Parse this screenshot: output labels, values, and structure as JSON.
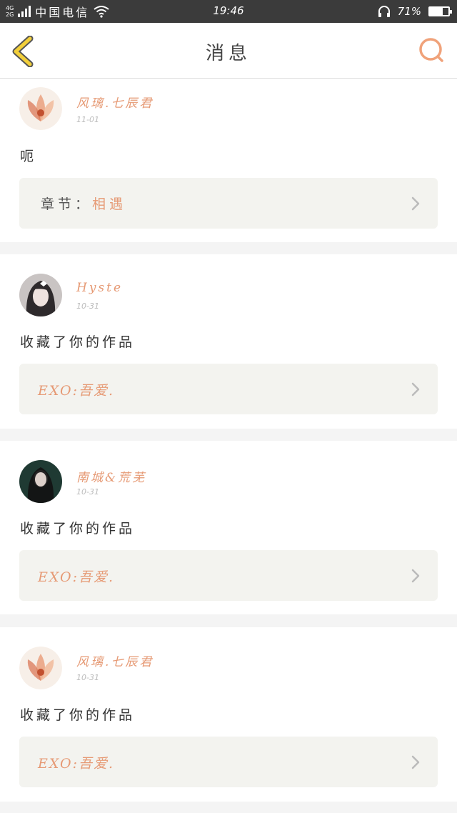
{
  "status": {
    "net_top": "4G",
    "net_bottom": "2G",
    "carrier": "中国电信",
    "time": "19:46",
    "battery": "71%",
    "battery_level": 0.71
  },
  "header": {
    "title": "消息"
  },
  "messages": [
    {
      "name": "风璃.七辰君",
      "date": "11-01",
      "text": "呃",
      "ref_label": "章节：",
      "ref_value": "相遇"
    },
    {
      "name": "Hyste",
      "date": "10-31",
      "text": "收藏了你的作品",
      "work": "EXO:吾爱."
    },
    {
      "name": "南城&荒芜",
      "date": "10-31",
      "text": "收藏了你的作品",
      "work": "EXO:吾爱."
    },
    {
      "name": "风璃.七辰君",
      "date": "10-31",
      "text": "收藏了你的作品",
      "work": "EXO:吾爱."
    }
  ],
  "colors": {
    "accent": "#e69a75",
    "back_arrow": "#f2cf3a",
    "ref_bg": "#f3f3ef"
  }
}
